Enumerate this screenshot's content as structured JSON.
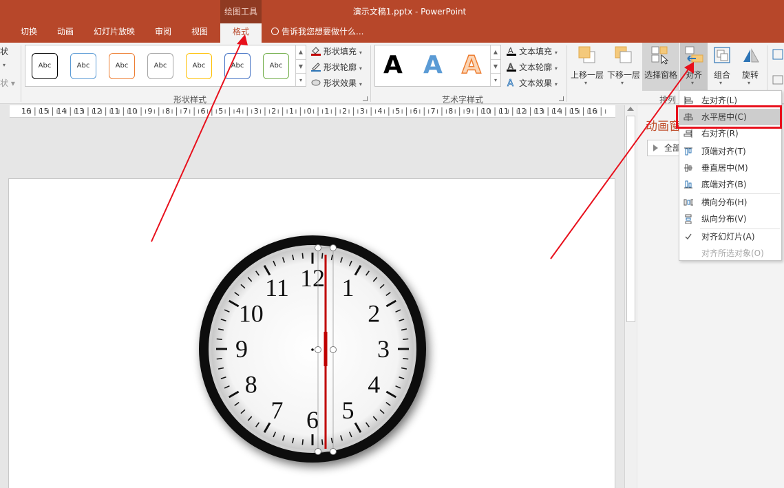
{
  "titlebar": {
    "context_group": "绘图工具",
    "doc_title": "演示文稿1.pptx - PowerPoint",
    "tabs": [
      "切换",
      "动画",
      "幻灯片放映",
      "审阅",
      "视图"
    ],
    "active_tab": "格式",
    "tell_me": "告诉我您想要做什么..."
  },
  "ribbon": {
    "left_partial": [
      "状",
      "▾",
      "状 ▾"
    ],
    "shape_styles": {
      "sample_label": "Abc",
      "sample_colors": [
        "#000000",
        "#5b9bd5",
        "#ed7d31",
        "#a5a5a5",
        "#ffc000",
        "#4472c4",
        "#70ad47"
      ],
      "commands": [
        "形状填充",
        "形状轮廓",
        "形状效果"
      ],
      "group_label": "形状样式"
    },
    "wordart": {
      "letter": "A",
      "styles": [
        "black",
        "blue",
        "orange-outline"
      ],
      "commands": [
        "文本填充",
        "文本轮廓",
        "文本效果"
      ],
      "group_label": "艺术字样式"
    },
    "arrange": {
      "buttons": [
        "上移一层",
        "下移一层",
        "选择窗格",
        "对齐",
        "组合",
        "旋转"
      ],
      "group_label": "排列"
    }
  },
  "ruler": {
    "labels": [
      "16",
      "15",
      "14",
      "13",
      "12",
      "11",
      "10",
      "9",
      "8",
      "7",
      "6",
      "5",
      "4",
      "3",
      "2",
      "1",
      "0",
      "1",
      "2",
      "3",
      "4",
      "5",
      "6",
      "7",
      "8",
      "9",
      "10",
      "11",
      "12",
      "13",
      "14",
      "15",
      "16"
    ]
  },
  "pane": {
    "title": "动画窗格",
    "play_button": "全部"
  },
  "align_menu": {
    "items": [
      {
        "label": "左对齐(L)",
        "icon": "align-left-icon",
        "enabled": true
      },
      {
        "label": "水平居中(C)",
        "icon": "align-center-icon",
        "enabled": true,
        "highlighted": true
      },
      {
        "label": "右对齐(R)",
        "icon": "align-right-icon",
        "enabled": true
      },
      {
        "label": "顶端对齐(T)",
        "icon": "align-top-icon",
        "enabled": true
      },
      {
        "label": "垂直居中(M)",
        "icon": "align-middle-icon",
        "enabled": true
      },
      {
        "label": "底端对齐(B)",
        "icon": "align-bottom-icon",
        "enabled": true
      },
      {
        "label": "横向分布(H)",
        "icon": "distribute-horizontal-icon",
        "enabled": true
      },
      {
        "label": "纵向分布(V)",
        "icon": "distribute-vertical-icon",
        "enabled": true
      },
      {
        "label": "对齐幻灯片(A)",
        "icon": "checkmark-icon",
        "enabled": true,
        "checked": true
      },
      {
        "label": "对齐所选对象(O)",
        "icon": "",
        "enabled": false
      }
    ]
  },
  "clock": {
    "numerals": [
      "12",
      "1",
      "2",
      "3",
      "4",
      "5",
      "6",
      "7",
      "8",
      "9",
      "10",
      "11"
    ]
  },
  "colors": {
    "accent": "#b7472a",
    "annotation": "#e8101c",
    "hand": "#c00000"
  }
}
